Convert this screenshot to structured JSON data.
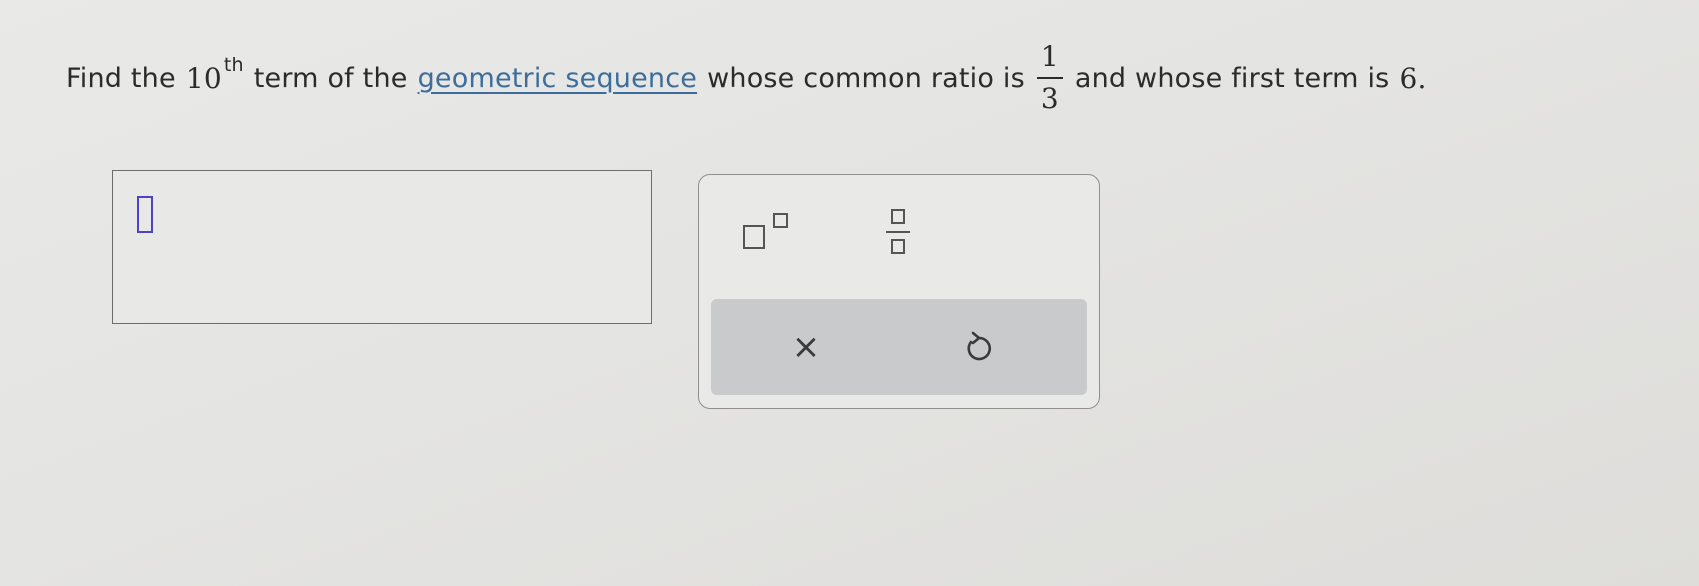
{
  "question": {
    "text_find": "Find the",
    "ordinal_number": "10",
    "ordinal_suffix": "th",
    "text_term_of_the": "term of the",
    "link_text": "geometric sequence",
    "text_ratio": "whose common ratio is",
    "ratio_numerator": "1",
    "ratio_denominator": "3",
    "text_first_term": "and whose first term is",
    "first_term_value": "6."
  },
  "answer": {
    "value": ""
  },
  "keypad": {
    "exponent_key": "exponent-template",
    "fraction_key": "fraction-template",
    "clear_glyph": "×",
    "undo_icon": "undo-icon"
  },
  "colors": {
    "link": "#3d6d9c",
    "cursor": "#4b44c8",
    "action_bar": "#c8cacb"
  }
}
